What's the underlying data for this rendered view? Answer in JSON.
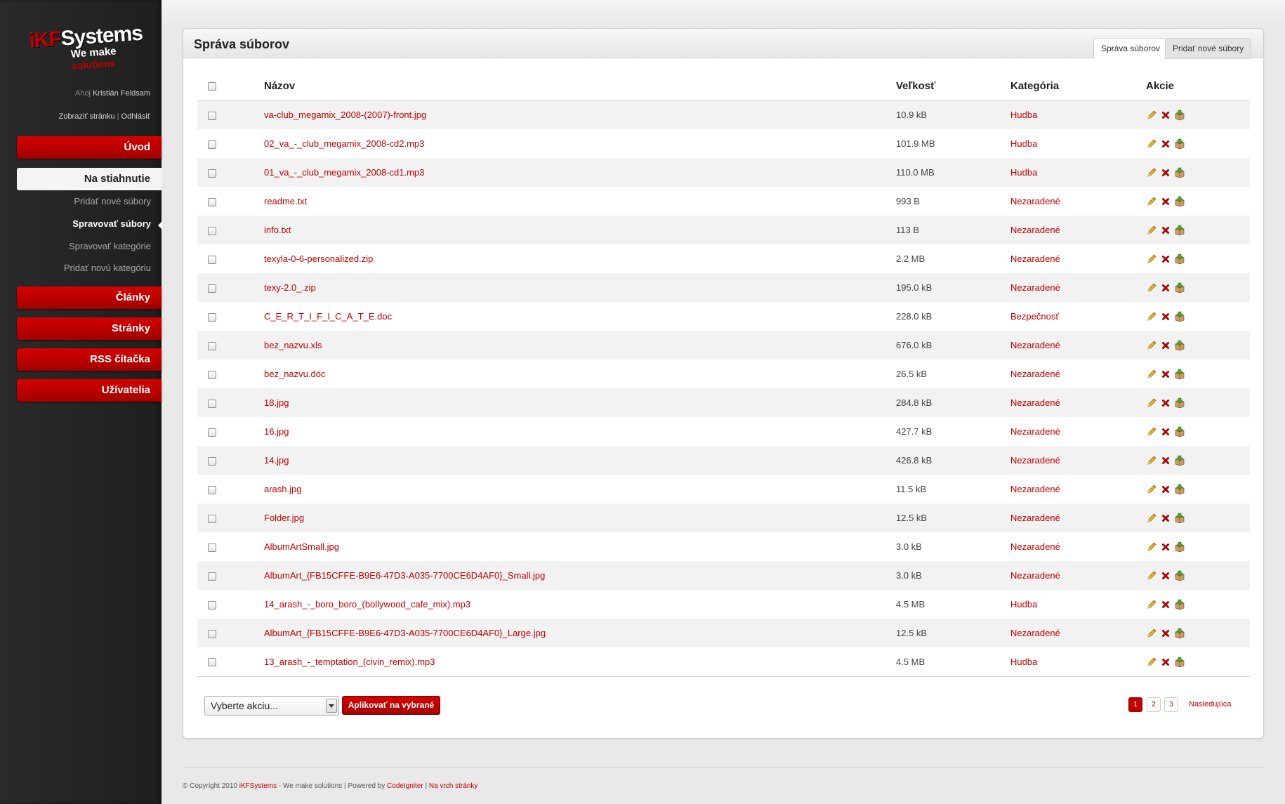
{
  "brand": {
    "logo_main_a": "iKF",
    "logo_main_b": "Systems",
    "logo_sub_a": "We make",
    "logo_sub_b": "solutions"
  },
  "user": {
    "greeting": "Ahoj",
    "name": "Kristián Feldsam",
    "view_link": "Zobraziť stránku",
    "separator": "|",
    "logout_link": "Odhlásiť"
  },
  "sidebar": {
    "uvod": "Úvod",
    "na_stiahnutie": "Na stiahnutie",
    "sub": [
      "Pridať nové súbory",
      "Spravovať súbory",
      "Spravovať kategórie",
      "Pridať novú kategóriu"
    ],
    "clanky": "Články",
    "stranky": "Stránky",
    "rss": "RSS čítačka",
    "uzivatelia": "Užívatelia"
  },
  "panel": {
    "title": "Správa súborov",
    "tabs": [
      "Správa súborov",
      "Pridať nové súbory"
    ]
  },
  "table": {
    "headers": {
      "name": "Názov",
      "size": "Veľkosť",
      "category": "Kategória",
      "actions": "Akcie"
    },
    "rows": [
      {
        "name": "va-club_megamix_2008-(2007)-front.jpg",
        "size": "10.9 kB",
        "category": "Hudba"
      },
      {
        "name": "02_va_-_club_megamix_2008-cd2.mp3",
        "size": "101.9 MB",
        "category": "Hudba"
      },
      {
        "name": "01_va_-_club_megamix_2008-cd1.mp3",
        "size": "110.0 MB",
        "category": "Hudba"
      },
      {
        "name": "readme.txt",
        "size": "993 B",
        "category": "Nezaradené"
      },
      {
        "name": "info.txt",
        "size": "113 B",
        "category": "Nezaradené"
      },
      {
        "name": "texyla-0-6-personalized.zip",
        "size": "2.2 MB",
        "category": "Nezaradené"
      },
      {
        "name": "texy-2.0_.zip",
        "size": "195.0 kB",
        "category": "Nezaradené"
      },
      {
        "name": "C_E_R_T_I_F_I_C_A_T_E.doc",
        "size": "228.0 kB",
        "category": "Bezpečnosť"
      },
      {
        "name": "bez_nazvu.xls",
        "size": "676.0 kB",
        "category": "Nezaradené"
      },
      {
        "name": "bez_nazvu.doc",
        "size": "26.5 kB",
        "category": "Nezaradené"
      },
      {
        "name": "18.jpg",
        "size": "284.8 kB",
        "category": "Nezaradené"
      },
      {
        "name": "16.jpg",
        "size": "427.7 kB",
        "category": "Nezaradené"
      },
      {
        "name": "14.jpg",
        "size": "426.8 kB",
        "category": "Nezaradené"
      },
      {
        "name": "arash.jpg",
        "size": "11.5 kB",
        "category": "Nezaradené"
      },
      {
        "name": "Folder.jpg",
        "size": "12.5 kB",
        "category": "Nezaradené"
      },
      {
        "name": "AlbumArtSmall.jpg",
        "size": "3.0 kB",
        "category": "Nezaradené"
      },
      {
        "name": "AlbumArt_{FB15CFFE-B9E6-47D3-A035-7700CE6D4AF0}_Small.jpg",
        "size": "3.0 kB",
        "category": "Nezaradené"
      },
      {
        "name": "14_arash_-_boro_boro_(bollywood_cafe_mix).mp3",
        "size": "4.5 MB",
        "category": "Hudba"
      },
      {
        "name": "AlbumArt_{FB15CFFE-B9E6-47D3-A035-7700CE6D4AF0}_Large.jpg",
        "size": "12.5 kB",
        "category": "Nezaradené"
      },
      {
        "name": "13_arash_-_temptation_(civin_remix).mp3",
        "size": "4.5 MB",
        "category": "Hudba"
      }
    ],
    "action_icons": [
      "edit-pencil-icon",
      "delete-x-icon",
      "package-box-icon"
    ]
  },
  "bulk": {
    "select_value": "Vyberte akciu...",
    "apply_label": "Aplikovať na vybrané"
  },
  "pagination": {
    "pages": [
      "1",
      "2",
      "3"
    ],
    "current": "1",
    "next": "Nasledujúca"
  },
  "footer": {
    "copyright": "© Copyright 2010",
    "brand": "iKFSystems",
    "tagline": "- We make solutions |",
    "powered": "Powered by",
    "ci": "CodeIgniter",
    "sep": "|",
    "top_link": "Na vrch stránky"
  },
  "colors": {
    "accent": "#c00000",
    "sidebar_bg": "#262626",
    "row_stripe": "#f2f2f2"
  }
}
